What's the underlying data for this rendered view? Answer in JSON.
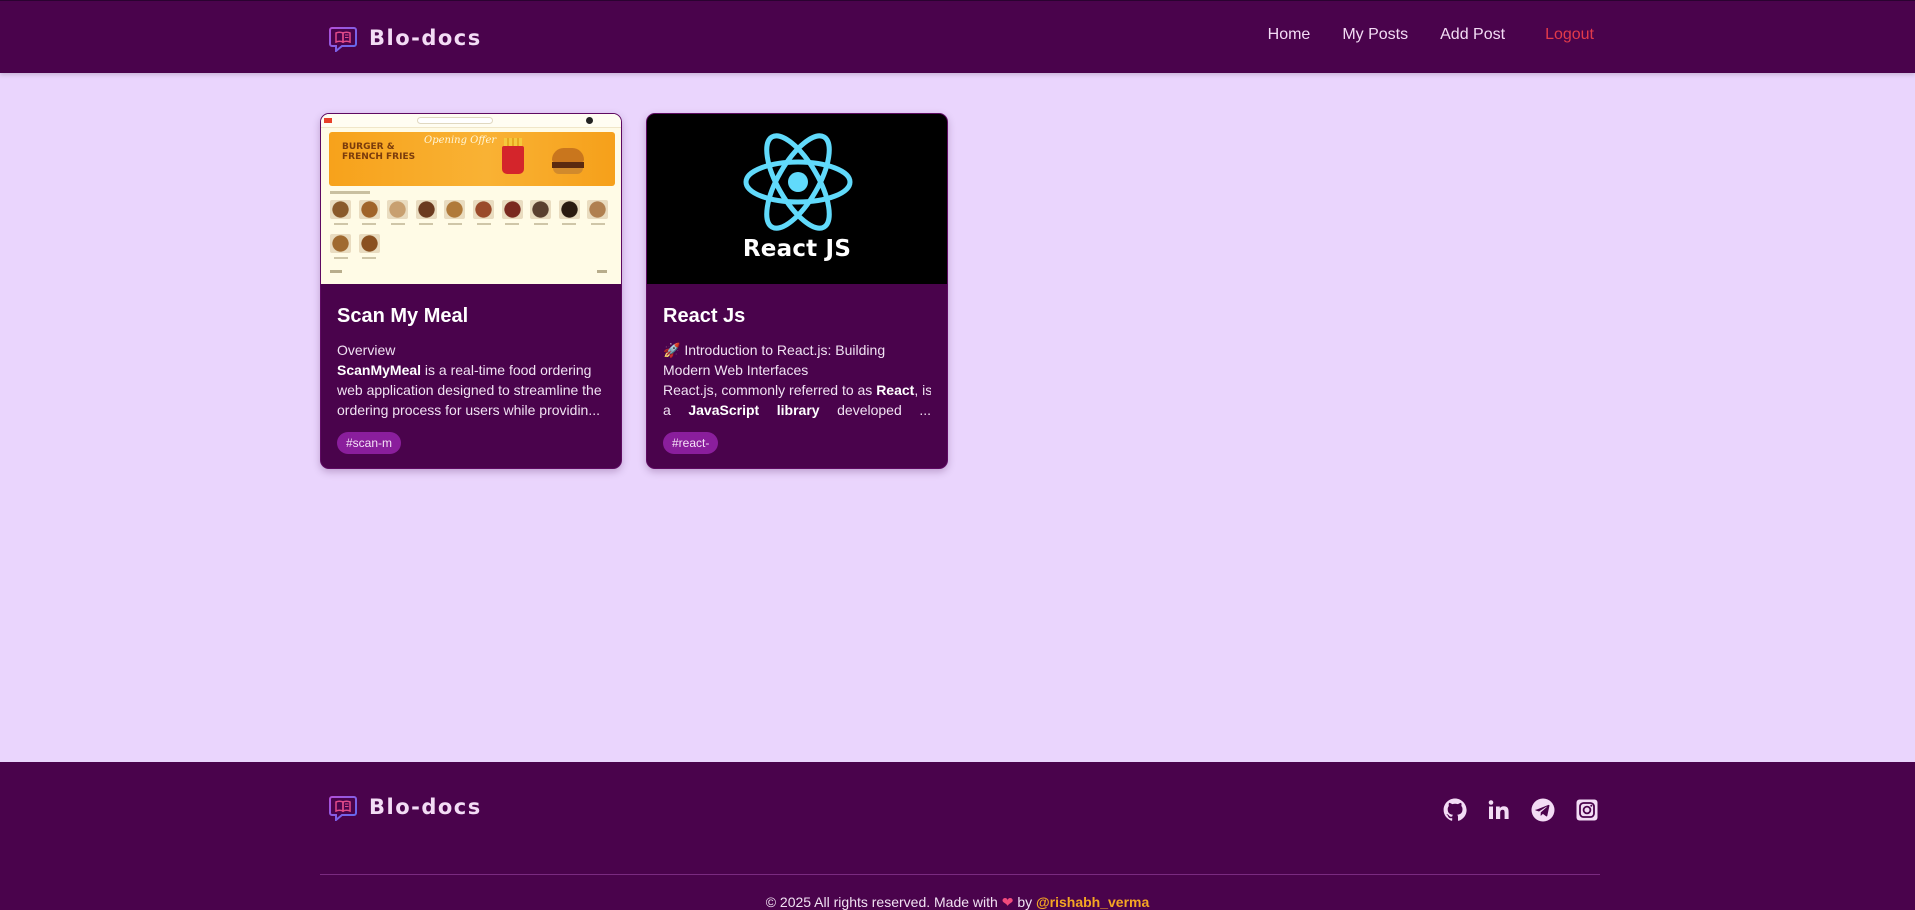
{
  "brand": {
    "name": "Blo-docs"
  },
  "nav": {
    "home": "Home",
    "my_posts": "My Posts",
    "add_post": "Add Post",
    "logout": "Logout"
  },
  "posts": [
    {
      "title": "Scan My Meal",
      "excerpt_heading": "Overview",
      "excerpt_bold": "ScanMyMeal",
      "excerpt_line1_rest": " is a real-time food ordering",
      "excerpt_line2": "web application designed to streamline the",
      "excerpt_line3": "ordering process for users while providin...",
      "tag": "#scan-m",
      "thumbnail": {
        "banner_title_1": "BURGER &",
        "banner_title_2": "FRENCH FRIES",
        "banner_script": "Opening Offer"
      }
    },
    {
      "title": "React Js",
      "excerpt_line1": "🚀 Introduction to React.js: Building",
      "excerpt_line2": "Modern Web Interfaces",
      "excerpt_line3_pre": "React.js, commonly referred to as ",
      "excerpt_line3_bold": "React",
      "excerpt_line3_post": ", is",
      "excerpt_line4_a": "a",
      "excerpt_line4_b": "JavaScript",
      "excerpt_line4_c": "library",
      "excerpt_line4_d": "developed",
      "excerpt_line4_e": "...",
      "tag": "#react-",
      "thumbnail": {
        "label": "React JS"
      }
    }
  ],
  "footer": {
    "brand_name": "Blo-docs",
    "social_icons": [
      "github-icon",
      "linkedin-icon",
      "telegram-icon",
      "instagram-icon"
    ],
    "copyright_pre": "© 2025 All rights reserved. Made with",
    "heart": "❤",
    "by": "by",
    "author": "@rishabh_verma"
  },
  "colors": {
    "page_bg": "#ead5fd",
    "header_bg": "#4a034c",
    "tag_bg": "#8a1e9c",
    "logout": "#e23a4a",
    "author": "#f5a623",
    "react_logo": "#61dafb"
  }
}
